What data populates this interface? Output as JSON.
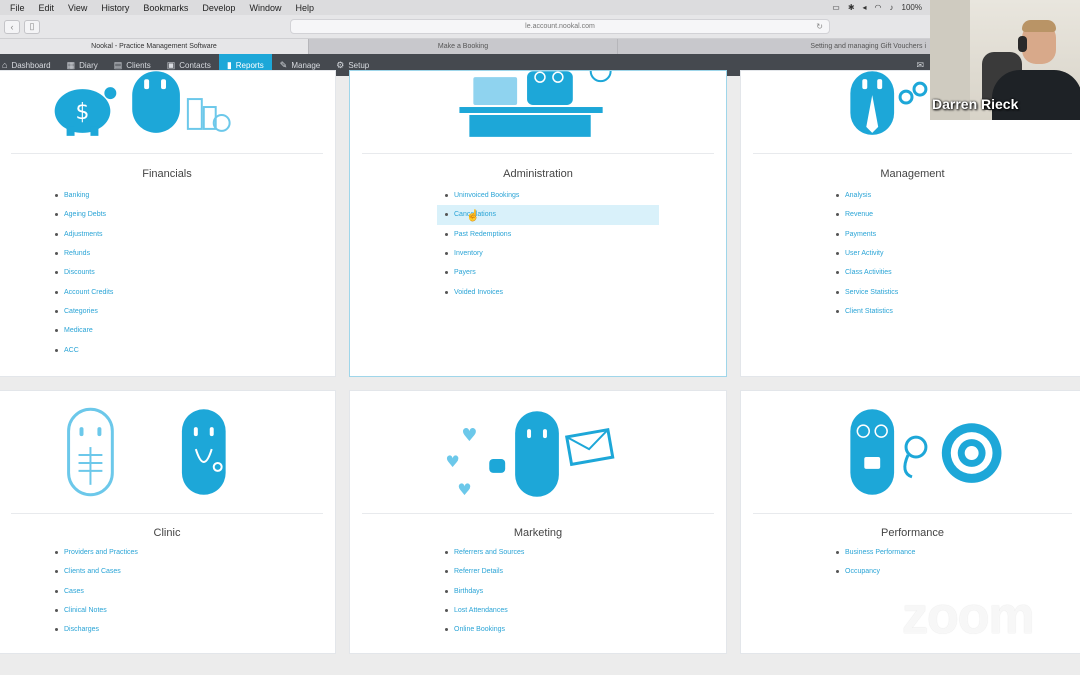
{
  "menubar": {
    "items": [
      "File",
      "Edit",
      "View",
      "History",
      "Bookmarks",
      "Develop",
      "Window",
      "Help"
    ],
    "battery": "100%"
  },
  "browser": {
    "url": "le.account.nookal.com",
    "tabs": [
      "Nookal - Practice Management Software",
      "Make a Booking",
      "Setting and managing Gift Vouchers i"
    ]
  },
  "appnav": {
    "items": [
      {
        "label": "Dashboard",
        "icon": "home-icon"
      },
      {
        "label": "Diary",
        "icon": "calendar-icon"
      },
      {
        "label": "Clients",
        "icon": "clients-icon"
      },
      {
        "label": "Contacts",
        "icon": "contacts-icon"
      },
      {
        "label": "Reports",
        "icon": "bar-chart-icon",
        "active": true
      },
      {
        "label": "Manage",
        "icon": "wrench-icon"
      },
      {
        "label": "Setup",
        "icon": "gear-icon"
      }
    ]
  },
  "webcam": {
    "name": "Darren Rieck"
  },
  "zoom_watermark": "zoom",
  "colors": {
    "accent": "#1da7d8",
    "nav_bg": "#45494f",
    "link": "#2aa4d6"
  },
  "reports": {
    "financials": {
      "title": "Financials",
      "links": [
        "Banking",
        "Ageing Debts",
        "Adjustments",
        "Refunds",
        "Discounts",
        "Account Credits",
        "Categories",
        "Medicare",
        "ACC"
      ]
    },
    "administration": {
      "title": "Administration",
      "links": [
        "Uninvoiced Bookings",
        "Cancellations",
        "Past Redemptions",
        "Inventory",
        "Payers",
        "Voided Invoices"
      ]
    },
    "management": {
      "title": "Management",
      "links": [
        "Analysis",
        "Revenue",
        "Payments",
        "User Activity",
        "Class Activities",
        "Service Statistics",
        "Client Statistics"
      ]
    },
    "clinic": {
      "title": "Clinic",
      "links": [
        "Providers and Practices",
        "Clients and Cases",
        "Cases",
        "Clinical Notes",
        "Discharges"
      ]
    },
    "marketing": {
      "title": "Marketing",
      "links": [
        "Referrers and Sources",
        "Referrer Details",
        "Birthdays",
        "Lost Attendances",
        "Online Bookings"
      ]
    },
    "performance": {
      "title": "Performance",
      "links": [
        "Business Performance",
        "Occupancy"
      ]
    }
  }
}
